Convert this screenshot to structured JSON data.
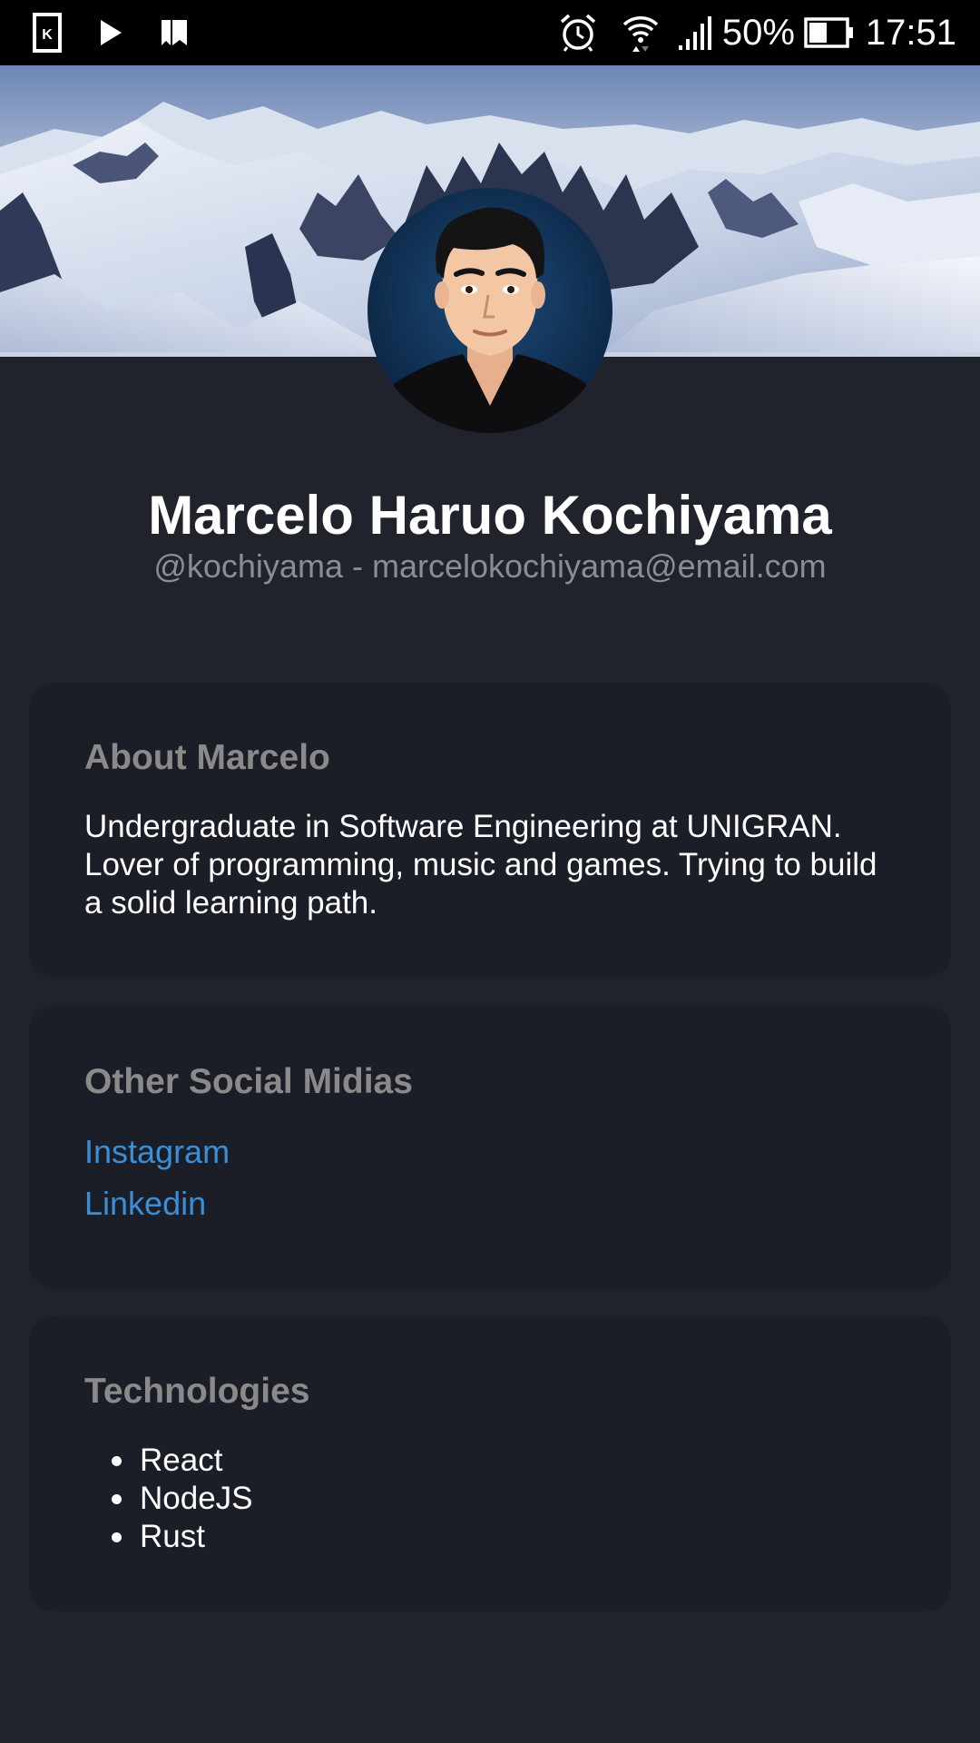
{
  "status_bar": {
    "left_icons": [
      "kindle-app-icon",
      "play-icon",
      "bookmarks-icon"
    ],
    "right_icons": [
      "alarm-icon",
      "wifi-icon",
      "signal-icon",
      "battery-icon"
    ],
    "battery_percent": "50%",
    "time": "17:51"
  },
  "profile": {
    "banner": "snowy-mountains-banner",
    "avatar": "cartoon-avatar",
    "name": "Marcelo Haruo Kochiyama",
    "subtitle": "@kochiyama - marcelokochiyama@email.com"
  },
  "about": {
    "title": "About Marcelo",
    "text": "Undergraduate in Software Engineering at UNIGRAN. Lover of programming, music and games. Trying to build a solid learning path."
  },
  "social": {
    "title": "Other Social Midias",
    "links": [
      {
        "label": "Instagram"
      },
      {
        "label": "Linkedin"
      }
    ]
  },
  "technologies": {
    "title": "Technologies",
    "items": [
      "React",
      "NodeJS",
      "Rust"
    ]
  },
  "colors": {
    "page_background": "#20232c",
    "card_background": "#1b1e27",
    "title_gray": "#8a8a8a",
    "link_blue": "#3a8fd8"
  }
}
